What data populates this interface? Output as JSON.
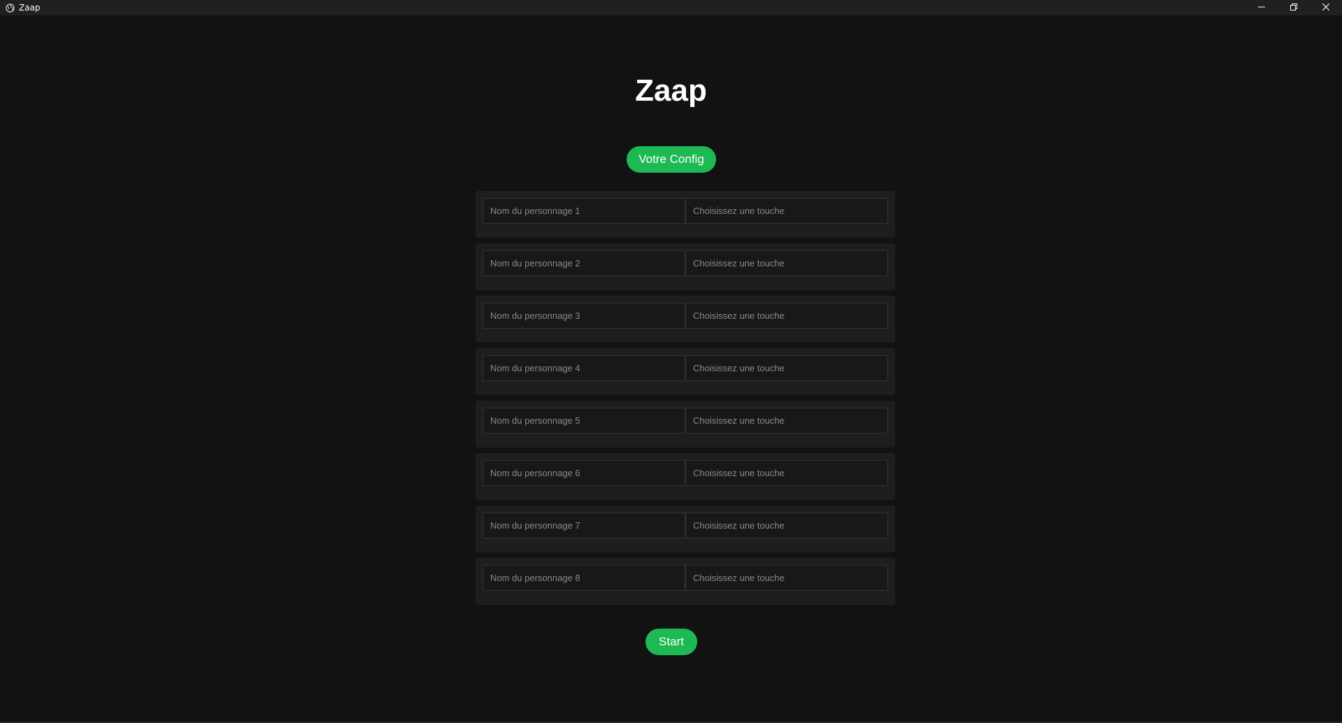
{
  "window": {
    "title": "Zaap",
    "icons": {
      "app": "globe-icon",
      "minimize": "minimize-icon",
      "maximize": "restore-icon",
      "close": "close-icon"
    }
  },
  "main": {
    "heading": "Zaap",
    "config_button": "Votre Config",
    "start_button": "Start",
    "rows": [
      {
        "name_placeholder": "Nom du personnage 1",
        "key_placeholder": "Choisissez une touche"
      },
      {
        "name_placeholder": "Nom du personnage 2",
        "key_placeholder": "Choisissez une touche"
      },
      {
        "name_placeholder": "Nom du personnage 3",
        "key_placeholder": "Choisissez une touche"
      },
      {
        "name_placeholder": "Nom du personnage 4",
        "key_placeholder": "Choisissez une touche"
      },
      {
        "name_placeholder": "Nom du personnage 5",
        "key_placeholder": "Choisissez une touche"
      },
      {
        "name_placeholder": "Nom du personnage 6",
        "key_placeholder": "Choisissez une touche"
      },
      {
        "name_placeholder": "Nom du personnage 7",
        "key_placeholder": "Choisissez une touche"
      },
      {
        "name_placeholder": "Nom du personnage 8",
        "key_placeholder": "Choisissez une touche"
      }
    ]
  },
  "colors": {
    "accent": "#1db954",
    "background": "#121212",
    "row_background": "#1e1e1e",
    "titlebar": "#202020"
  }
}
